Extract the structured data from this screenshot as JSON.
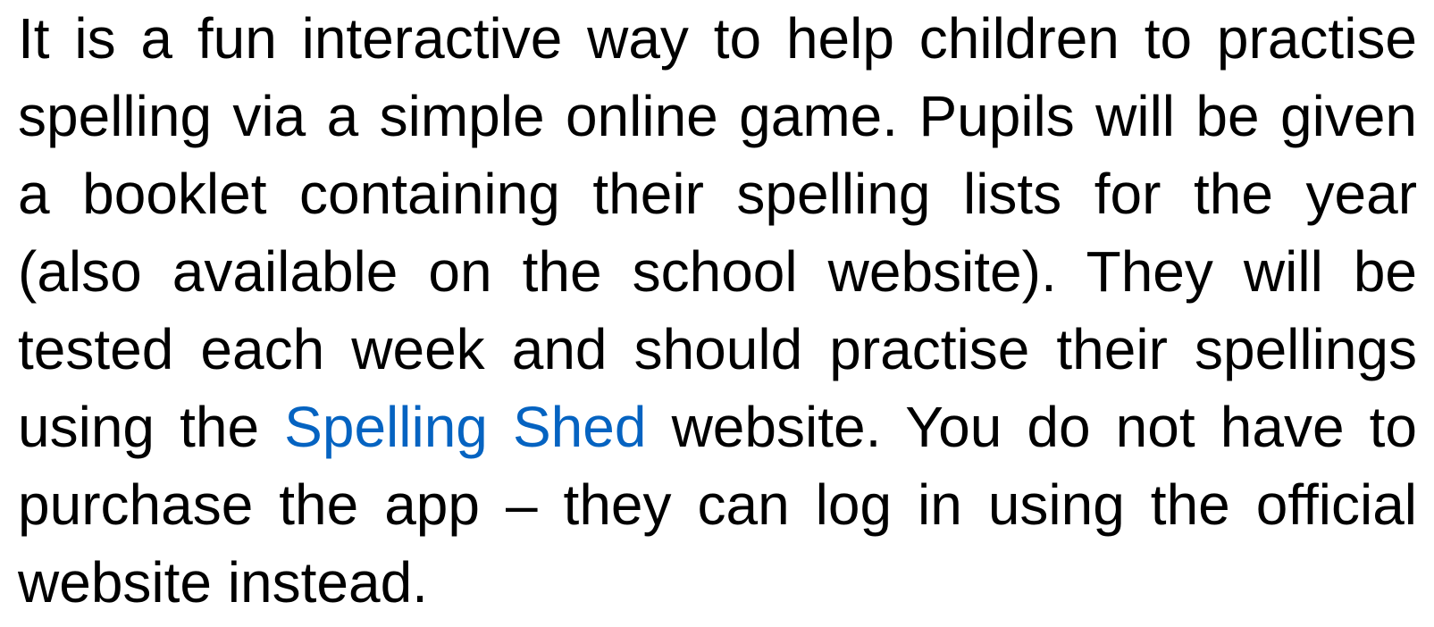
{
  "paragraph": {
    "text_before_link": "It is a fun interactive way to help children to practise spelling via a simple online game. Pupils will be given a booklet containing their spelling lists for the year (also available on the school website). They will be tested each week and should practise their spellings using the ",
    "link_text": "Spelling Shed",
    "text_after_link": " website. You do not have to purchase the app – they can log in using the official website instead.",
    "link_color": "#0563c1"
  }
}
